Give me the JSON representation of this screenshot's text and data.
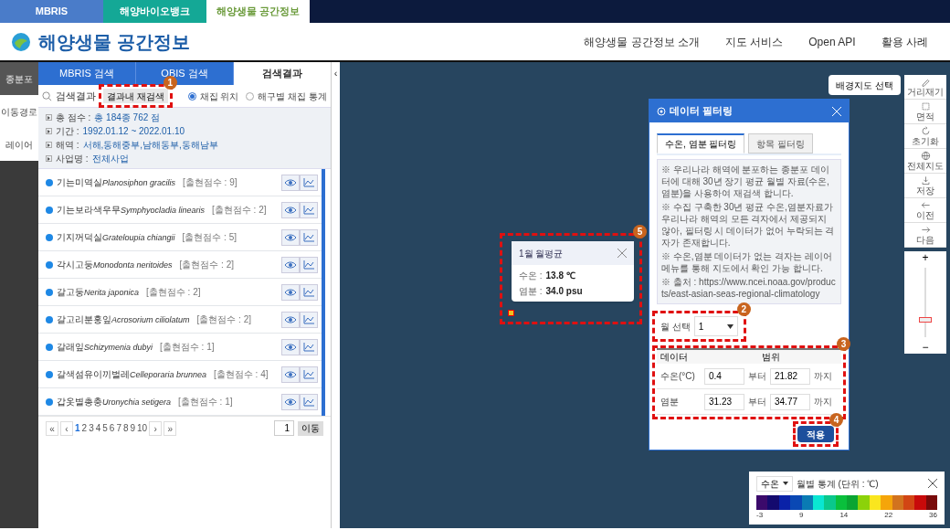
{
  "site_tabs": [
    {
      "label": "MBRIS",
      "kind": "blue",
      "selected": false
    },
    {
      "label": "해양바이오뱅크",
      "kind": "teal",
      "selected": false
    },
    {
      "label": "해양생물 공간정보",
      "kind": "plain",
      "selected": true
    }
  ],
  "header": {
    "title": "해양생물 공간정보",
    "nav": [
      "해양생물 공간정보 소개",
      "지도 서비스",
      "Open API",
      "활용 사례"
    ]
  },
  "rail": [
    {
      "label": "종분포",
      "selected": true
    },
    {
      "label": "이동경로",
      "selected": false
    },
    {
      "label": "레이어",
      "selected": false
    }
  ],
  "panel_tabs": [
    {
      "label": "MBRIS 검색",
      "selected": false
    },
    {
      "label": "OBIS 검색",
      "selected": false
    },
    {
      "label": "검색결과",
      "selected": true
    }
  ],
  "search": {
    "title": "검색결과",
    "button": "결과내 재검색",
    "radios": [
      {
        "label": "채집 위치",
        "selected": true
      },
      {
        "label": "해구별 채집 통계",
        "selected": false
      }
    ]
  },
  "summary": [
    {
      "label": "총 점수 :",
      "value": "총 184종 762 점"
    },
    {
      "label": "기간 :",
      "value": "1992.01.12 ~ 2022.01.10"
    },
    {
      "label": "해역 :",
      "value": "서해,동해중부,남해동부,동해남부"
    },
    {
      "label": "사업명 :",
      "value": "전체사업"
    }
  ],
  "species": [
    {
      "name_ko": "기는미역실",
      "name_sci": "Planosiphon gracilis",
      "count": "[출현점수 : 9]"
    },
    {
      "name_ko": "기는보라색우무",
      "name_sci": "Symphyocladia linearis",
      "count": "[출현점수 : 2]"
    },
    {
      "name_ko": "기지꺼덕실",
      "name_sci": "Grateloupia chiangii",
      "count": "[출현점수 : 5]"
    },
    {
      "name_ko": "각시고둥",
      "name_sci": "Monodonta neritoides",
      "count": "[출현점수 : 2]"
    },
    {
      "name_ko": "갈고둥",
      "name_sci": "Nerita japonica",
      "count": "[출현점수 : 2]"
    },
    {
      "name_ko": "갈고리분홍잎",
      "name_sci": "Acrosorium ciliolatum",
      "count": "[출현점수 : 2]"
    },
    {
      "name_ko": "갈래잎",
      "name_sci": "Schizymenia dubyi",
      "count": "[출현점수 : 1]"
    },
    {
      "name_ko": "갈색섬유이끼벌레",
      "name_sci": "Celleporaria brunnea",
      "count": "[출현점수 : 4]"
    },
    {
      "name_ko": "갑옷별총충",
      "name_sci": "Uronychia setigera",
      "count": "[출현점수 : 1]"
    }
  ],
  "pagination": {
    "first": "«",
    "prev": "‹",
    "pages": [
      {
        "label": "1",
        "selected": true
      },
      {
        "label": "2",
        "selected": false
      },
      {
        "label": "3",
        "selected": false
      },
      {
        "label": "4",
        "selected": false
      },
      {
        "label": "5",
        "selected": false
      },
      {
        "label": "6",
        "selected": false
      },
      {
        "label": "7",
        "selected": false
      },
      {
        "label": "8",
        "selected": false
      },
      {
        "label": "9",
        "selected": false
      },
      {
        "label": "10",
        "selected": false
      }
    ],
    "next": "›",
    "last": "»",
    "page_input": "1",
    "go": "이동"
  },
  "collapse": "‹",
  "basemap_button": "배경지도 선택",
  "tools": [
    "거리재기",
    "면적",
    "초기화",
    "전체지도",
    "저장",
    "이전",
    "다음"
  ],
  "zoom": {
    "in": "+",
    "out": "−",
    "level": 0.25
  },
  "dialog": {
    "title": "데이터 필터링",
    "tabs": [
      {
        "label": "수온, 염분 필터링",
        "selected": true
      },
      {
        "label": "항목 필터링",
        "selected": false
      }
    ],
    "notes": [
      "※ 우리나라 해역에 분포하는 종분포 데이터에 대해 30년 장기 평균 월별 자료(수온, 염분)을 사용하여 재검색 합니다.",
      "※ 수집 구축한 30년 평균 수온,염분자료가 우리나라 해역의 모든 격자에서 제공되지 않아, 필터링 시 데이터가 없어 누락되는 격자가 존재합니다.",
      "※ 수온,염분 데이터가 없는 격자는 레이어 메뉴를 통해 지도에서 확인 가능 합니다.",
      "※ 출처 : https://www.ncei.noaa.gov/products/east-asian-seas-regional-climatology"
    ],
    "month_label": "월 선택",
    "month": "1",
    "columns": [
      "데이터",
      "범위"
    ],
    "rows": [
      {
        "label": "수온(°C)",
        "from": "0.4",
        "from_word": "부터",
        "to": "21.82",
        "to_word": "까지"
      },
      {
        "label": "염분",
        "from": "31.23",
        "from_word": "부터",
        "to": "34.77",
        "to_word": "까지"
      }
    ],
    "apply": "적용"
  },
  "popup": {
    "title": "1월 월평균",
    "lines": [
      {
        "label": "수온 :",
        "value": "13.8 ℃"
      },
      {
        "label": "염분 :",
        "value": "34.0 psu"
      }
    ]
  },
  "legend": {
    "select": "수온",
    "title": "월별 통계 (단위 : ℃)",
    "colors": [
      {
        "color": "#3b0a6b"
      },
      {
        "color": "#140a6e"
      },
      {
        "color": "#0a22a8"
      },
      {
        "color": "#0a48b4"
      },
      {
        "color": "#0a7bb4"
      },
      {
        "color": "#0ae6d2"
      },
      {
        "color": "#0ac88c"
      },
      {
        "color": "#0ac03c"
      },
      {
        "color": "#0aa532"
      },
      {
        "color": "#8cd20a"
      },
      {
        "color": "#fae61e"
      },
      {
        "color": "#f5a50a"
      },
      {
        "color": "#d2731e"
      },
      {
        "color": "#d24614"
      },
      {
        "color": "#c80a0a"
      },
      {
        "color": "#780a0a"
      }
    ],
    "ticks": [
      "-3",
      "9",
      "14",
      "22",
      "36"
    ]
  },
  "callouts": [
    "1",
    "2",
    "3",
    "4",
    "5"
  ]
}
